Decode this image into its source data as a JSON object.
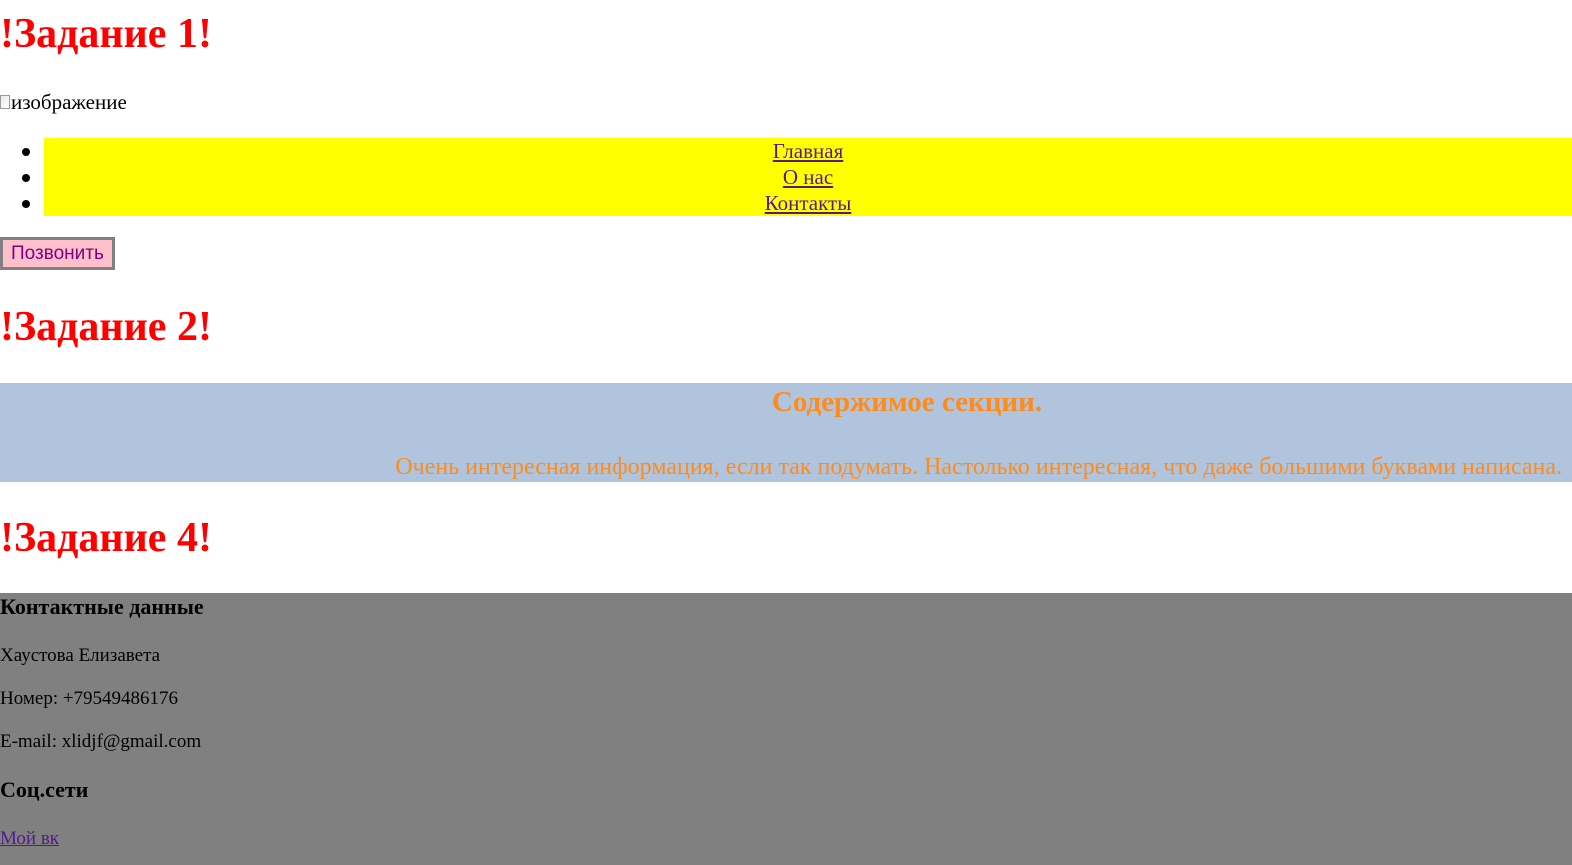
{
  "task1": {
    "title": "!Задание 1!",
    "image_alt": "изображение",
    "nav_items": [
      {
        "label": "Главная"
      },
      {
        "label": "О нас"
      },
      {
        "label": "Контакты"
      }
    ],
    "call_button": "Позвонить"
  },
  "task2": {
    "title": "!Задание 2!",
    "section_heading": "Содержимое секции.",
    "section_text": "Очень интересная информация, если так подумать. Настолько интересная, что даже большими буквами написана."
  },
  "task4": {
    "title": "!Задание 4!",
    "contacts_heading": "Контактные данные",
    "name": "Хаустова Елизавета",
    "phone": "Номер: +79549486176",
    "email": "E-mail: xlidjf@gmail.com",
    "social_heading": "Соц.сети",
    "social_link": "Мой вк"
  },
  "colors": {
    "title": "#ff0000",
    "nav_bg": "#ffff00",
    "link": "#551a8b",
    "button_bg": "#ffc0cb",
    "button_text": "#800080",
    "section_bg": "#b0c4de",
    "section_text": "#ff8c1a",
    "footer_bg": "#808080"
  }
}
